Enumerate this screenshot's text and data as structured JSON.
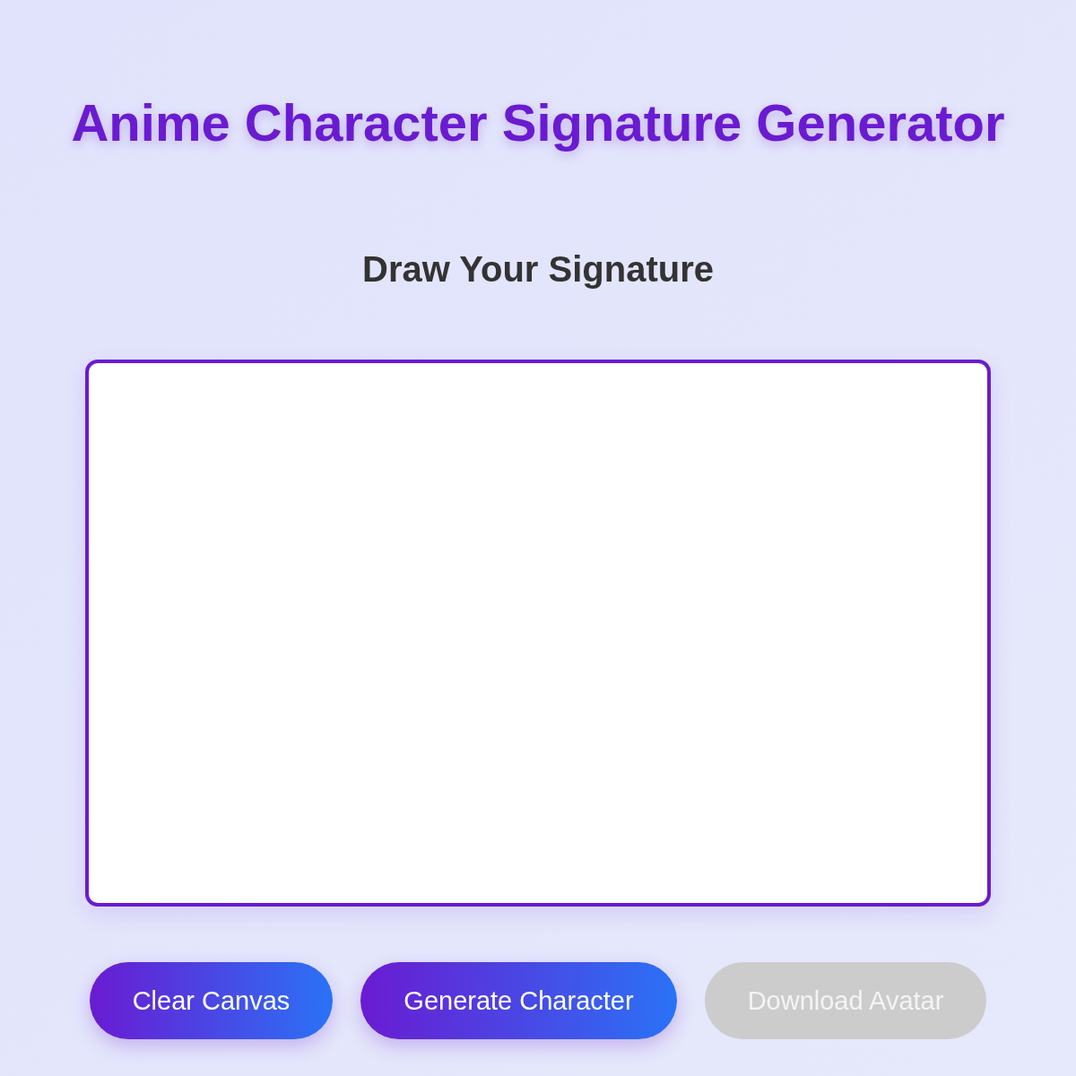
{
  "title": "Anime Character Signature Generator",
  "heading": "Draw Your Signature",
  "buttons": [
    {
      "label": "Clear Canvas",
      "disabled": false
    },
    {
      "label": "Generate Character",
      "disabled": false
    },
    {
      "label": "Download Avatar",
      "disabled": true
    }
  ]
}
